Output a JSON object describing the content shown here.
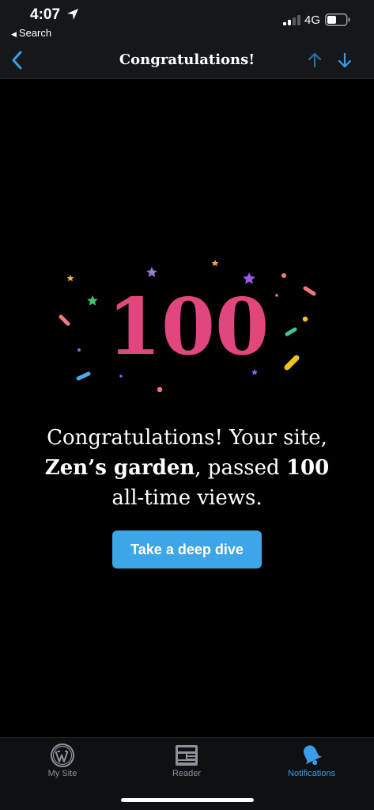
{
  "status_bar": {
    "time": "4:07",
    "back_label": "Search",
    "network": "4G",
    "icons": [
      "location-arrow-icon",
      "signal-icon",
      "battery-icon"
    ]
  },
  "nav": {
    "title": "Congratulations!",
    "icons": [
      "back-chevron-icon",
      "arrow-up-icon",
      "arrow-down-icon"
    ],
    "accent": "#3d9ce6"
  },
  "milestone": {
    "number": "100",
    "number_color": "#e2467f",
    "message_prefix": "Congratulations! Your site,",
    "site_name": "Zen’s garden",
    "message_middle": ", passed ",
    "count": "100",
    "message_suffix": "all-time views."
  },
  "cta": {
    "label": "Take a deep dive",
    "color": "#3da6e8"
  },
  "tab_bar": {
    "tabs": [
      {
        "label": "My Site",
        "icon": "wordpress-icon",
        "active": false
      },
      {
        "label": "Reader",
        "icon": "reader-icon",
        "active": false
      },
      {
        "label": "Notifications",
        "icon": "bell-icon",
        "active": true
      }
    ]
  }
}
